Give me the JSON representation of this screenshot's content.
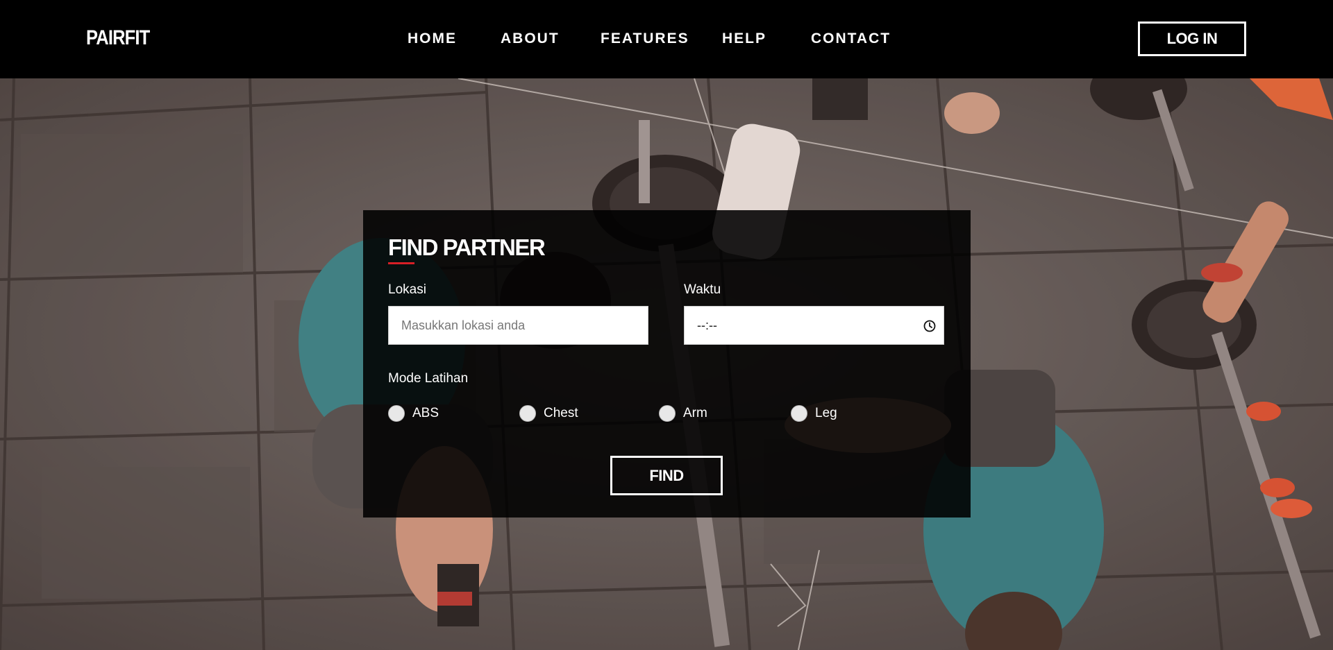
{
  "navbar": {
    "brand": "PAIRFIT",
    "links": [
      "HOME",
      "ABOUT",
      "FEATURES",
      "HELP",
      "CONTACT"
    ],
    "login_label": "LOG IN"
  },
  "form": {
    "title": "FIND PARTNER",
    "location": {
      "label": "Lokasi",
      "placeholder": "Masukkan lokasi anda",
      "value": ""
    },
    "time": {
      "label": "Waktu",
      "value": "--:--"
    },
    "mode": {
      "label": "Mode Latihan",
      "options": [
        "ABS",
        "Chest",
        "Arm",
        "Leg"
      ],
      "selected": null
    },
    "find_label": "FIND"
  },
  "colors": {
    "accent": "#d71f26",
    "navbar_bg": "#000000",
    "card_bg": "rgba(0,0,0,0.88)"
  },
  "icons": {
    "time_input": "clock-icon"
  }
}
